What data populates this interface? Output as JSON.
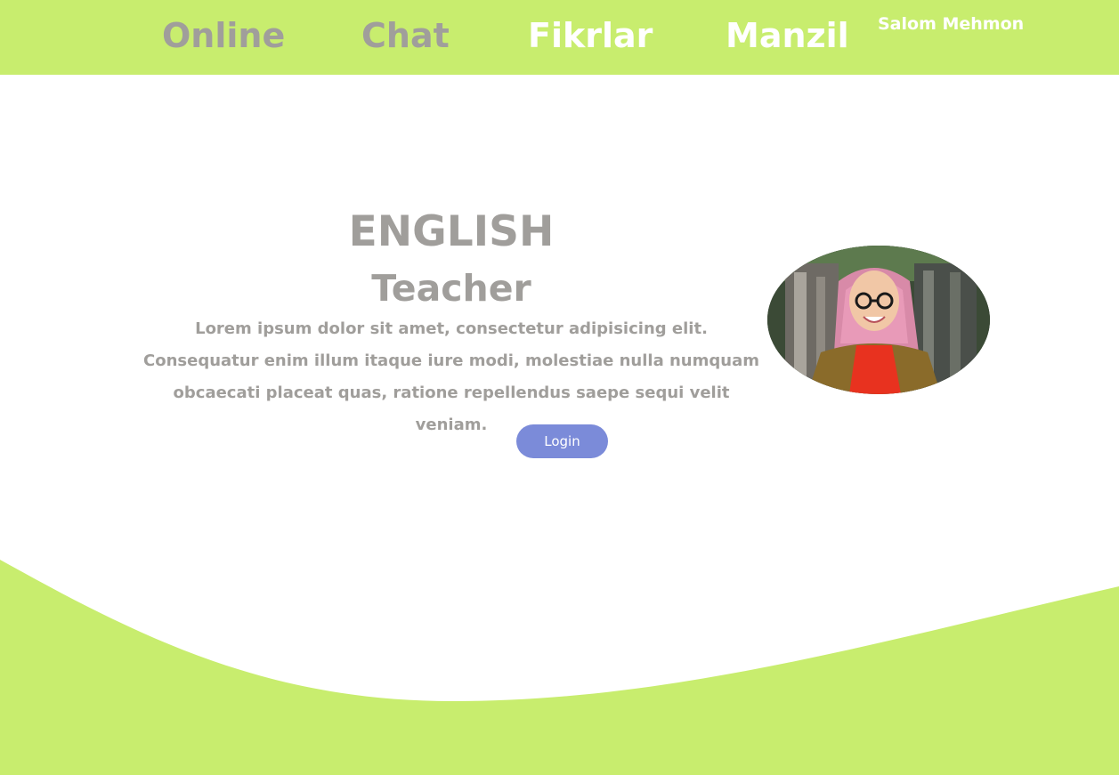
{
  "nav": {
    "items": [
      {
        "label": "Online"
      },
      {
        "label": "Chat"
      },
      {
        "label": "Fikrlar"
      },
      {
        "label": "Manzil"
      }
    ],
    "greeting": "Salom Mehmon"
  },
  "hero": {
    "title": "ENGLISH",
    "subtitle": "Teacher",
    "description": "Lorem ipsum dolor sit amet, consectetur adipisicing elit. Consequatur enim illum itaque iure modi, molestiae nulla numquam obcaecati placeat quas, ratione repellendus saepe sequi velit veniam.",
    "login_label": "Login"
  },
  "colors": {
    "accent_green": "#c8ed6e",
    "muted_text": "#a09e9b",
    "button_blue": "#7b8bd9"
  },
  "icons": {
    "photo": "teacher-portrait-photo"
  }
}
